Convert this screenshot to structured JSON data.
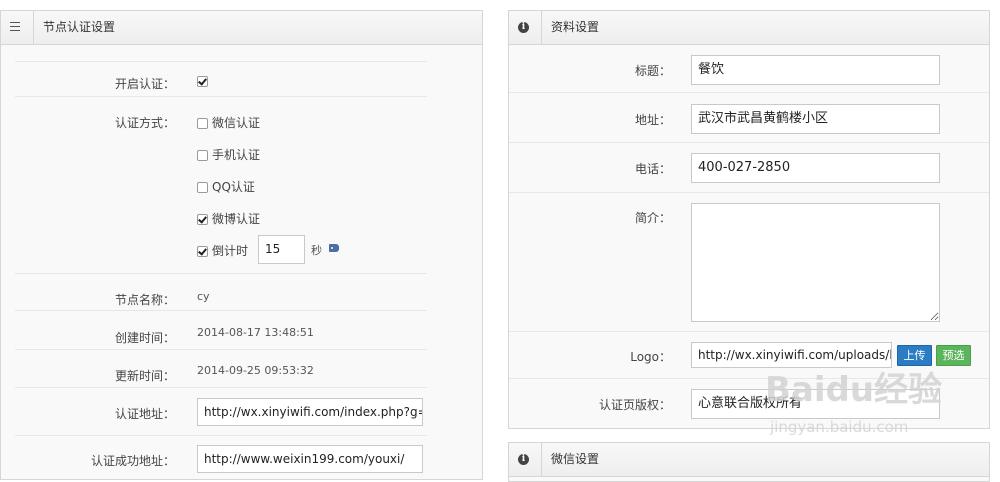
{
  "left_panel": {
    "title": "节点认证设置",
    "enable_label": "开启认证：",
    "method_label": "认证方式：",
    "methods": [
      {
        "label": "微信认证",
        "checked": false
      },
      {
        "label": "手机认证",
        "checked": false
      },
      {
        "label": "QQ认证",
        "checked": false
      },
      {
        "label": "微博认证",
        "checked": true
      },
      {
        "label": "倒计时",
        "checked": true
      }
    ],
    "countdown_value": "15",
    "countdown_unit": "秒",
    "node_name_label": "节点名称：",
    "node_name": "cy",
    "created_label": "创建时间：",
    "created": "2014-08-17 13:48:51",
    "updated_label": "更新时间：",
    "updated": "2014-09-25 09:53:32",
    "auth_url_label": "认证地址：",
    "auth_url": "http://wx.xinyiwifi.com/index.php?g=H",
    "success_url_label": "认证成功地址：",
    "success_url": "http://www.weixin199.com/youxi/"
  },
  "right_panel": {
    "title": "资料设置",
    "title_label": "标题：",
    "title_value": "餐饮",
    "address_label": "地址：",
    "address_value": "武汉市武昌黄鹤楼小区",
    "phone_label": "电话：",
    "phone_value": "400-027-2850",
    "intro_label": "简介：",
    "intro_value": "",
    "logo_label": "Logo：",
    "logo_value": "http://wx.xinyiwifi.com/uploads/l/lk",
    "upload_button": "上传",
    "preview_button": "预选",
    "copyright_label": "认证页版权：",
    "copyright_value": "心意联合版权所有"
  },
  "wechat_panel": {
    "title": "微信设置"
  },
  "watermark": {
    "brand": "Baidu经验",
    "url": "jingyan.baidu.com"
  }
}
